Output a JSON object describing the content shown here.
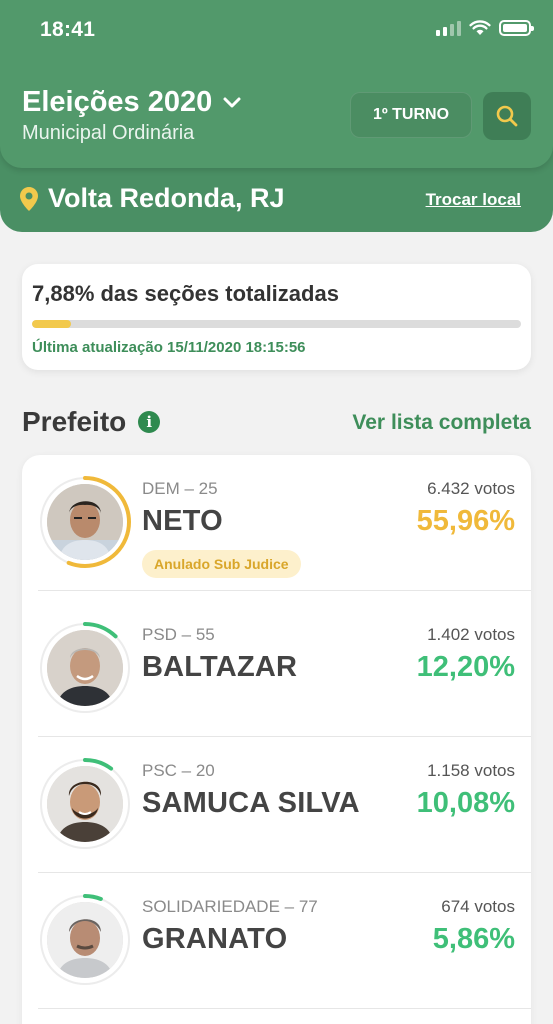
{
  "status_bar": {
    "time": "18:41"
  },
  "header": {
    "title": "Eleições 2020",
    "subtitle": "Municipal Ordinária",
    "turno_label": "1º TURNO",
    "location": "Volta Redonda, RJ",
    "change_location_label": "Trocar local",
    "colors": {
      "primary": "#52996b",
      "dark": "#4a8f64"
    }
  },
  "progress": {
    "label": "7,88% das seções totalizadas",
    "fraction": 0.0788,
    "last_update": "Última atualização 15/11/2020 18:15:56",
    "color": "#f2c94c"
  },
  "section": {
    "title": "Prefeito",
    "link_label": "Ver lista completa"
  },
  "candidates": [
    {
      "party": "DEM – 25",
      "name": "NETO",
      "votes": "6.432 votos",
      "percent": "55,96%",
      "share": 0.5596,
      "color": "#f0b93a",
      "badge": "Anulado Sub Judice"
    },
    {
      "party": "PSD – 55",
      "name": "BALTAZAR",
      "votes": "1.402 votos",
      "percent": "12,20%",
      "share": 0.122,
      "color": "#3fbf78"
    },
    {
      "party": "PSC – 20",
      "name": "SAMUCA SILVA",
      "votes": "1.158 votos",
      "percent": "10,08%",
      "share": 0.1008,
      "color": "#3fbf78"
    },
    {
      "party": "SOLIDARIEDADE – 77",
      "name": "GRANATO",
      "votes": "674 votos",
      "percent": "5,86%",
      "share": 0.0586,
      "color": "#3fbf78"
    }
  ]
}
